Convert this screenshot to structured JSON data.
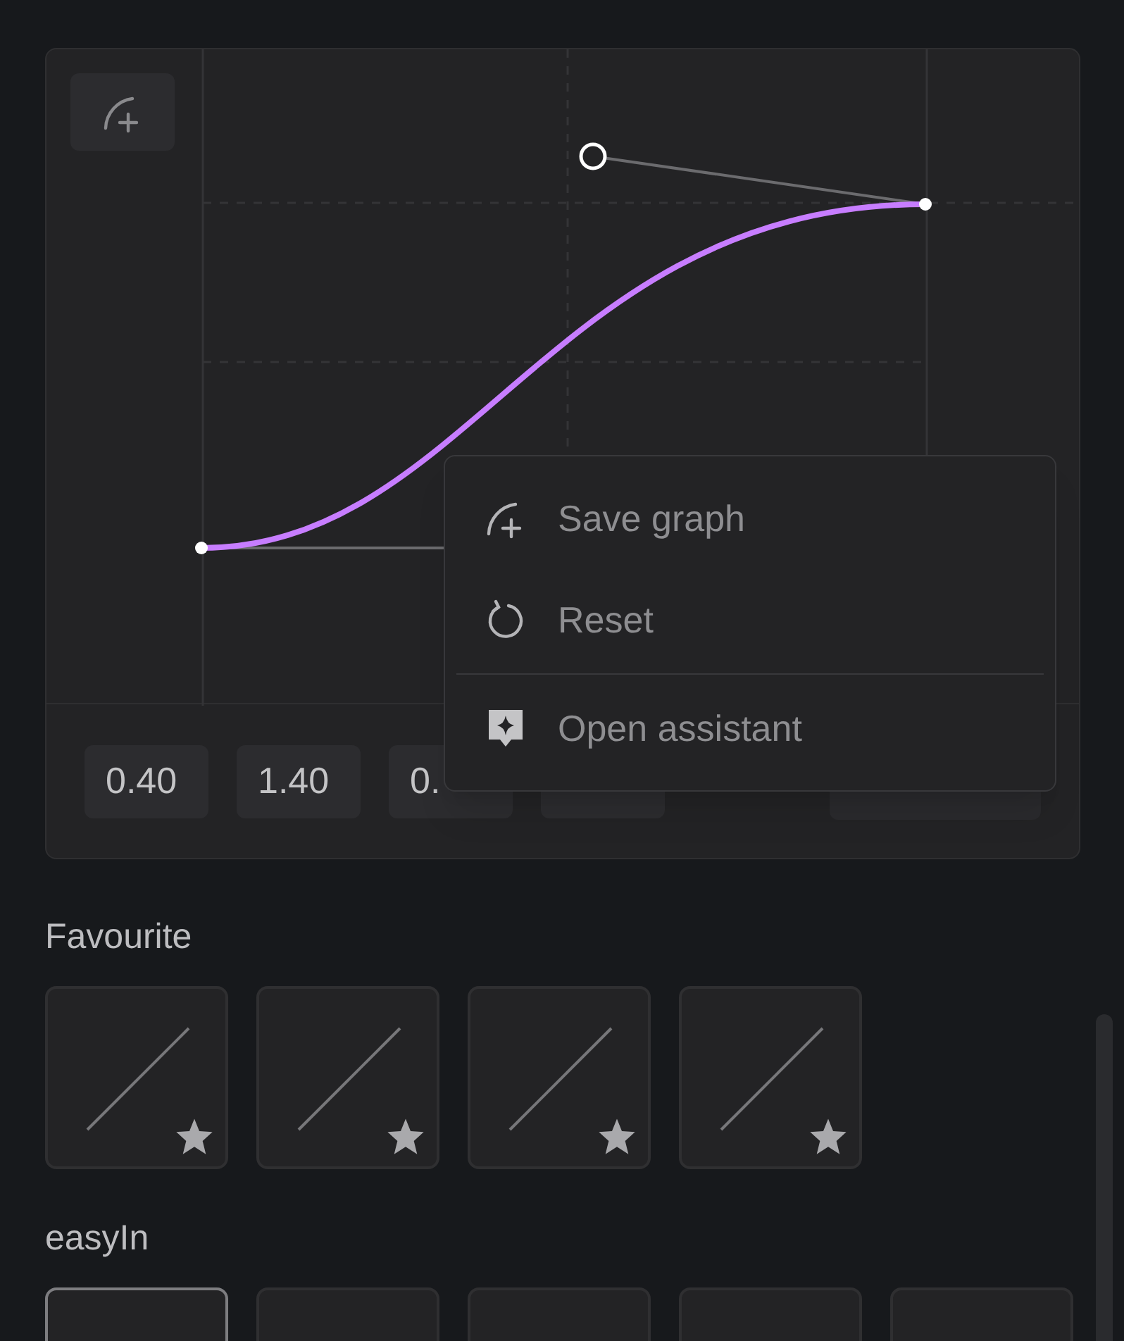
{
  "graph": {
    "add_button": {
      "kind": "save"
    }
  },
  "values": [
    {
      "kind": "number",
      "value": "0.40"
    },
    {
      "kind": "number",
      "value": "1.40"
    },
    {
      "kind": "number",
      "value": "0."
    },
    {
      "kind": "number"
    }
  ],
  "apply_button": {
    "kind": "apply"
  },
  "context_menu": {
    "items": [
      {
        "label": "Save graph",
        "kind": "save"
      },
      {
        "label": "Reset",
        "kind": "reset"
      },
      {
        "label": "Open assistant",
        "kind": "assistant"
      }
    ]
  },
  "sections": [
    {
      "title": "Favourite",
      "tiles": [
        {
          "favourite": true,
          "selected": false
        },
        {
          "favourite": true,
          "selected": false
        },
        {
          "favourite": true,
          "selected": false
        },
        {
          "favourite": true,
          "selected": false
        }
      ]
    },
    {
      "title": "easyIn",
      "tiles": [
        {
          "selected": true
        },
        {
          "selected": false
        },
        {
          "selected": false
        },
        {
          "selected": false
        },
        {
          "selected": false
        }
      ]
    }
  ]
}
